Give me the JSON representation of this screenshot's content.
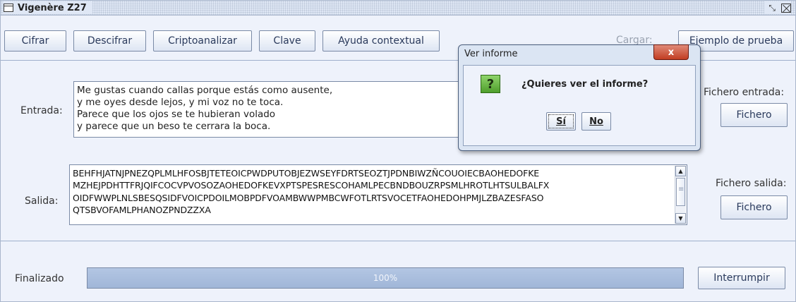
{
  "window": {
    "title": "Vigenère Z27",
    "min_glyph": "ㅁ",
    "restore_glyph": "⤡"
  },
  "toolbar": {
    "cifrar": "Cifrar",
    "descifrar": "Descifrar",
    "criptoanalizar": "Criptoanalizar",
    "clave": "Clave",
    "ayuda": "Ayuda contextual",
    "cargar": "Cargar:",
    "ejemplo": "Ejemplo de prueba"
  },
  "entrada": {
    "label": "Entrada:",
    "text": "Me gustas cuando callas porque estás como ausente,\ny me oyes desde lejos, y mi voz no te toca.\nParece que los ojos se te hubieran volado\ny parece que un beso te cerrara la boca.",
    "file_label": "Fichero entrada:",
    "file_button": "Fichero"
  },
  "salida": {
    "label": "Salida:",
    "text": "BEHFHJATNJPNEZQPLMLHFOSBJTETEOICPWDPUTOBJEZWSEYFDRTSEOZTJPDNBIWZÑCOUOIECBAOHEDOFKE\nMZHEJPDHTTFRJQIFCOCVPVOSOZAOHEDOFKEVXPTSPESRESCOHAMLPECBNDBOUZRPSMLHROTLHTSULBALFX\nOIDFWWPLNLSBESQSIDFVOICPDOILMOBPDFVOAMBWWPMBCWFOTLRTSVOCETFAOHEDOHPMJLZBAZESFASO\nQTSBVOFAMLPHANOZPNDZZXA",
    "file_label": "Fichero salida:",
    "file_button": "Fichero"
  },
  "status": {
    "label": "Finalizado",
    "progress_text": "100%",
    "progress": 1.0,
    "interrumpir": "Interrumpir"
  },
  "dialog": {
    "title": "Ver informe",
    "close": "x",
    "icon": "?",
    "question": "¿Quieres ver el informe?",
    "yes": "Sí",
    "no": "No"
  }
}
